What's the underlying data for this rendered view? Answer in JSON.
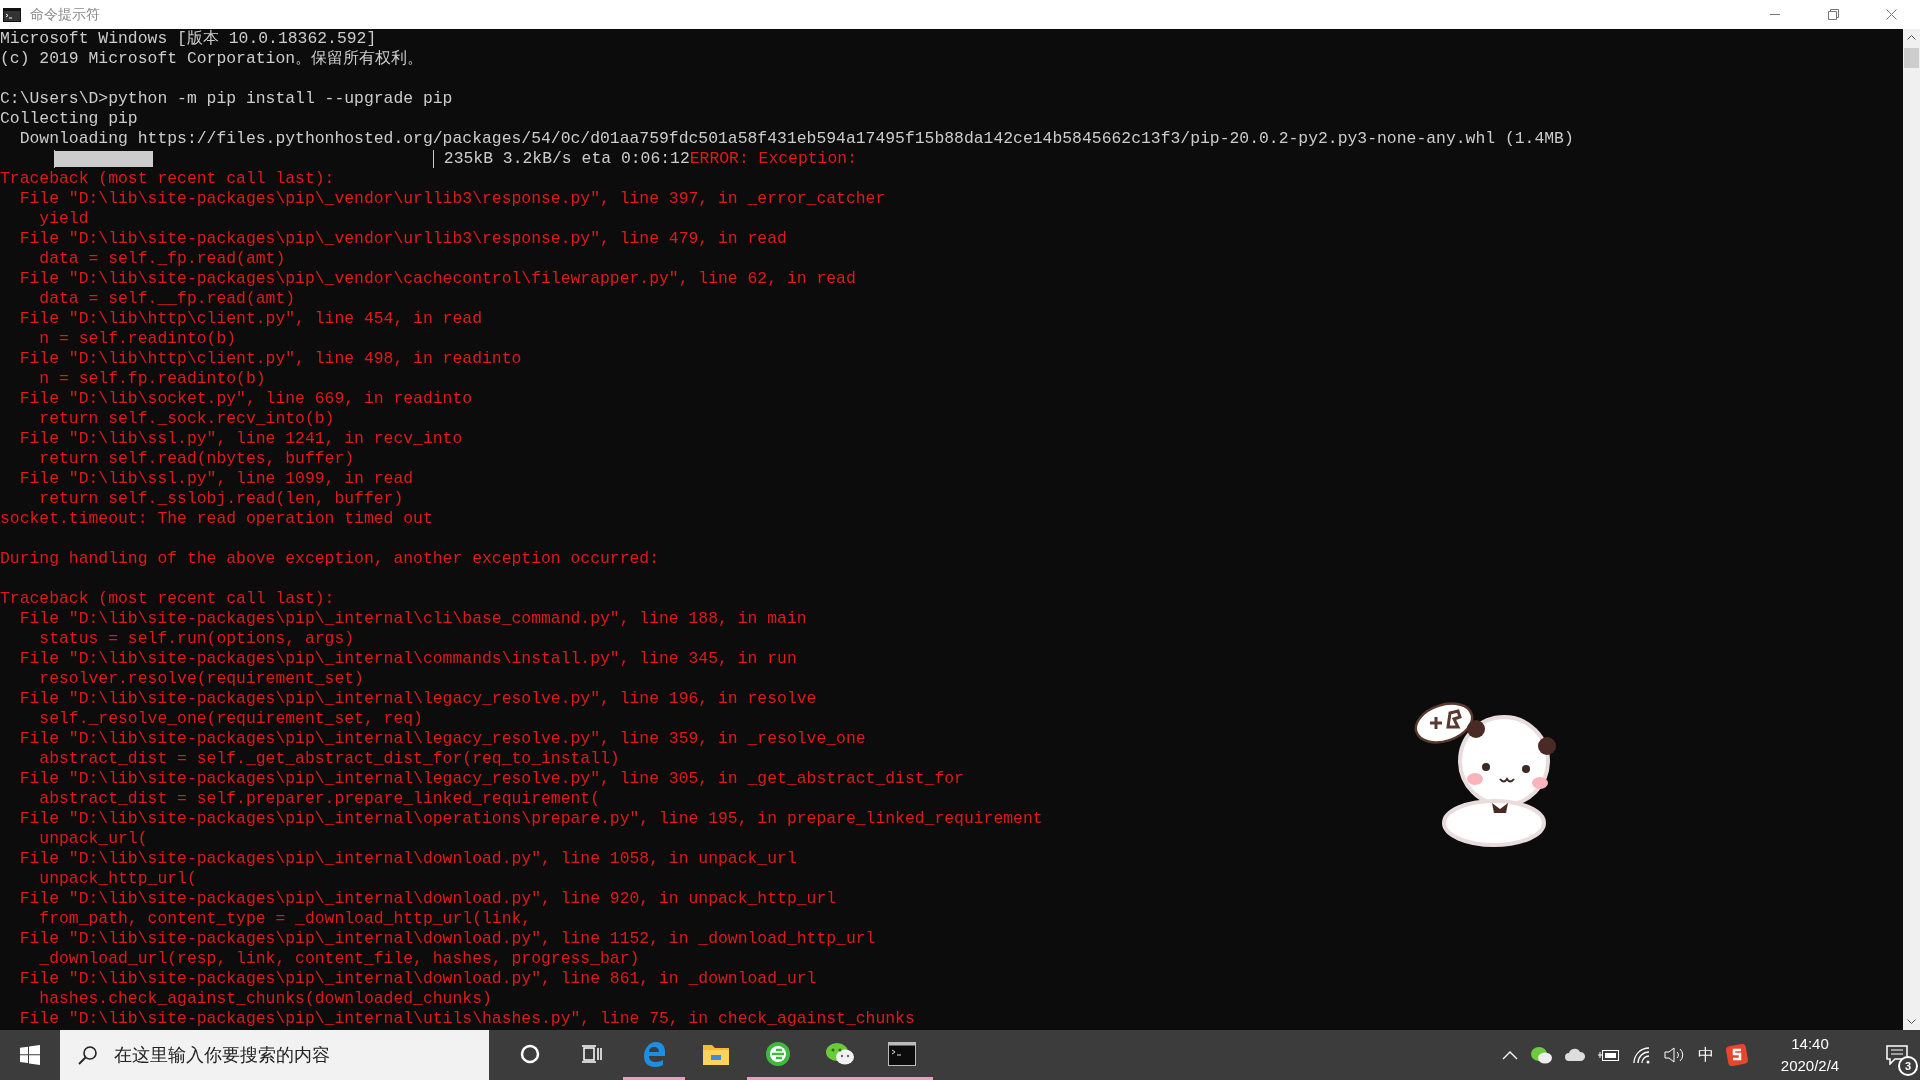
{
  "window": {
    "title": "命令提示符"
  },
  "console": {
    "lines": [
      {
        "kind": "text",
        "text": "Microsoft Windows [版本 10.0.18362.592]"
      },
      {
        "kind": "text",
        "text": "(c) 2019 Microsoft Corporation。保留所有权利。"
      },
      {
        "kind": "blank"
      },
      {
        "kind": "text",
        "text": "C:\\Users\\D>python -m pip install --upgrade pip"
      },
      {
        "kind": "text",
        "text": "Collecting pip"
      },
      {
        "kind": "text",
        "text": "  Downloading https://files.pythonhosted.org/packages/54/0c/d01aa759fdc501a58f431eb594a17495f15b88da142ce14b5845662c13f3/pip-20.0.2-py2.py3-none-any.whl (1.4MB)"
      },
      {
        "kind": "progress",
        "level": 0.26,
        "text": " 235kB 3.2kB/s eta 0:06:12",
        "error": "ERROR: Exception:"
      },
      {
        "kind": "error",
        "text": "Traceback (most recent call last):"
      },
      {
        "kind": "error",
        "text": "  File \"D:\\lib\\site-packages\\pip\\_vendor\\urllib3\\response.py\", line 397, in _error_catcher"
      },
      {
        "kind": "error",
        "text": "    yield"
      },
      {
        "kind": "error",
        "text": "  File \"D:\\lib\\site-packages\\pip\\_vendor\\urllib3\\response.py\", line 479, in read"
      },
      {
        "kind": "error",
        "text": "    data = self._fp.read(amt)"
      },
      {
        "kind": "error",
        "text": "  File \"D:\\lib\\site-packages\\pip\\_vendor\\cachecontrol\\filewrapper.py\", line 62, in read"
      },
      {
        "kind": "error",
        "text": "    data = self.__fp.read(amt)"
      },
      {
        "kind": "error",
        "text": "  File \"D:\\lib\\http\\client.py\", line 454, in read"
      },
      {
        "kind": "error",
        "text": "    n = self.readinto(b)"
      },
      {
        "kind": "error",
        "text": "  File \"D:\\lib\\http\\client.py\", line 498, in readinto"
      },
      {
        "kind": "error",
        "text": "    n = self.fp.readinto(b)"
      },
      {
        "kind": "error",
        "text": "  File \"D:\\lib\\socket.py\", line 669, in readinto"
      },
      {
        "kind": "error",
        "text": "    return self._sock.recv_into(b)"
      },
      {
        "kind": "error",
        "text": "  File \"D:\\lib\\ssl.py\", line 1241, in recv_into"
      },
      {
        "kind": "error",
        "text": "    return self.read(nbytes, buffer)"
      },
      {
        "kind": "error",
        "text": "  File \"D:\\lib\\ssl.py\", line 1099, in read"
      },
      {
        "kind": "error",
        "text": "    return self._sslobj.read(len, buffer)"
      },
      {
        "kind": "error",
        "text": "socket.timeout: The read operation timed out"
      },
      {
        "kind": "blank"
      },
      {
        "kind": "error",
        "text": "During handling of the above exception, another exception occurred:"
      },
      {
        "kind": "blank"
      },
      {
        "kind": "error",
        "text": "Traceback (most recent call last):"
      },
      {
        "kind": "error",
        "text": "  File \"D:\\lib\\site-packages\\pip\\_internal\\cli\\base_command.py\", line 188, in main"
      },
      {
        "kind": "error",
        "text": "    status = self.run(options, args)"
      },
      {
        "kind": "error",
        "text": "  File \"D:\\lib\\site-packages\\pip\\_internal\\commands\\install.py\", line 345, in run"
      },
      {
        "kind": "error",
        "text": "    resolver.resolve(requirement_set)"
      },
      {
        "kind": "error",
        "text": "  File \"D:\\lib\\site-packages\\pip\\_internal\\legacy_resolve.py\", line 196, in resolve"
      },
      {
        "kind": "error",
        "text": "    self._resolve_one(requirement_set, req)"
      },
      {
        "kind": "error",
        "text": "  File \"D:\\lib\\site-packages\\pip\\_internal\\legacy_resolve.py\", line 359, in _resolve_one"
      },
      {
        "kind": "error",
        "text": "    abstract_dist = self._get_abstract_dist_for(req_to_install)"
      },
      {
        "kind": "error",
        "text": "  File \"D:\\lib\\site-packages\\pip\\_internal\\legacy_resolve.py\", line 305, in _get_abstract_dist_for"
      },
      {
        "kind": "error",
        "text": "    abstract_dist = self.preparer.prepare_linked_requirement("
      },
      {
        "kind": "error",
        "text": "  File \"D:\\lib\\site-packages\\pip\\_internal\\operations\\prepare.py\", line 195, in prepare_linked_requirement"
      },
      {
        "kind": "error",
        "text": "    unpack_url("
      },
      {
        "kind": "error",
        "text": "  File \"D:\\lib\\site-packages\\pip\\_internal\\download.py\", line 1058, in unpack_url"
      },
      {
        "kind": "error",
        "text": "    unpack_http_url("
      },
      {
        "kind": "error",
        "text": "  File \"D:\\lib\\site-packages\\pip\\_internal\\download.py\", line 920, in unpack_http_url"
      },
      {
        "kind": "error",
        "text": "    from_path, content_type = _download_http_url(link,"
      },
      {
        "kind": "error",
        "text": "  File \"D:\\lib\\site-packages\\pip\\_internal\\download.py\", line 1152, in _download_http_url"
      },
      {
        "kind": "error",
        "text": "    _download_url(resp, link, content_file, hashes, progress_bar)"
      },
      {
        "kind": "error",
        "text": "  File \"D:\\lib\\site-packages\\pip\\_internal\\download.py\", line 861, in _download_url"
      },
      {
        "kind": "error",
        "text": "    hashes.check_against_chunks(downloaded_chunks)"
      },
      {
        "kind": "error",
        "text": "  File \"D:\\lib\\site-packages\\pip\\_internal\\utils\\hashes.py\", line 75, in check_against_chunks"
      }
    ]
  },
  "taskbar": {
    "search": {
      "placeholder": "在这里输入你要搜索的内容"
    },
    "apps": [
      {
        "kind": "cortana",
        "running": false
      },
      {
        "kind": "taskview",
        "running": false
      },
      {
        "kind": "edge",
        "running": true
      },
      {
        "kind": "explorer",
        "running": false
      },
      {
        "kind": "browser360",
        "running": true
      },
      {
        "kind": "wechat",
        "running": true
      },
      {
        "kind": "cmd",
        "running": true
      }
    ],
    "tray": {
      "ime": "中",
      "time": "14:40",
      "date": "2020/2/4",
      "notifications": "3"
    }
  }
}
